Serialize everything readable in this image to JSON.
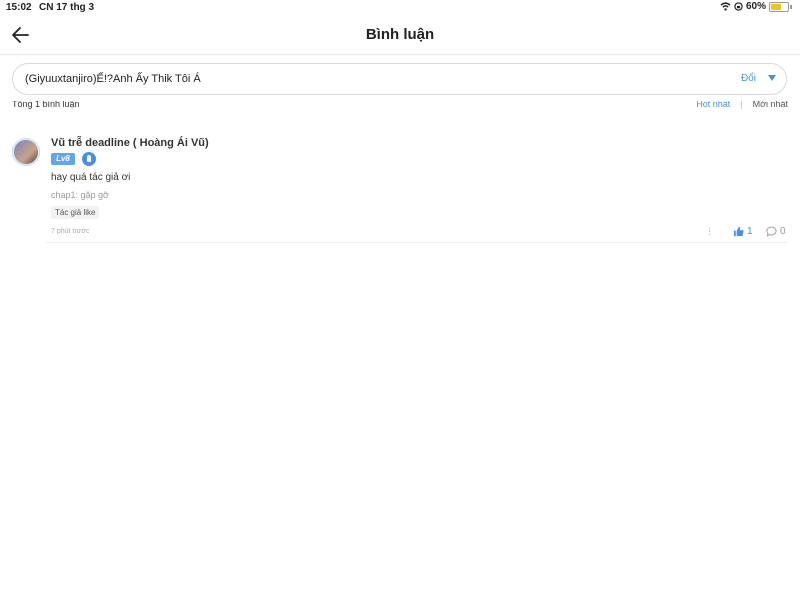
{
  "status_bar": {
    "time": "15:02",
    "date": "CN 17 thg 3",
    "battery_percent": "60%",
    "battery_level": 0.6
  },
  "nav": {
    "title": "Bình luận"
  },
  "story_selector": {
    "story_name": "(Giyuuxtanjiro)Ế!?Anh Ấy Thik Tôi Á",
    "change_label": "Đổi"
  },
  "comments_header": {
    "count_text": "Tổng 1 bình luận",
    "sort_hot": "Hot nhất",
    "sort_new": "Mới nhất"
  },
  "comment": {
    "user_name": "Vũ trễ deadline ( Hoàng Ái Vũ)",
    "level_badge": "Lv8",
    "text": "hay quá tác giả ơi",
    "chapter_ref": "chap1: gặp gỡ",
    "author_like_tag": "Tác giả like",
    "time_ago": "7 phút trước",
    "like_count": "1",
    "reply_count": "0"
  },
  "colors": {
    "accent": "#4a90e2",
    "badge": "#5fa6ee",
    "battery": "#f0c419"
  }
}
